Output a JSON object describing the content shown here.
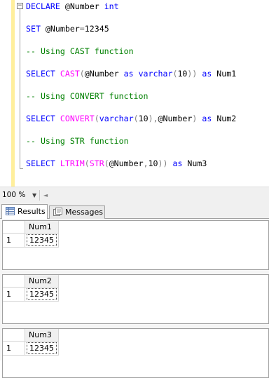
{
  "editor": {
    "collapse_glyph": "−",
    "lines": [
      {
        "segments": [
          {
            "t": "DECLARE ",
            "c": "kw"
          },
          {
            "t": "@Number ",
            "c": ""
          },
          {
            "t": "int",
            "c": "kw"
          }
        ]
      },
      {
        "segments": [
          {
            "t": "SET ",
            "c": "kw"
          },
          {
            "t": "@Number",
            "c": ""
          },
          {
            "t": "=",
            "c": "op"
          },
          {
            "t": "12345",
            "c": ""
          }
        ]
      },
      {
        "segments": [
          {
            "t": "-- Using CAST function",
            "c": "cm"
          }
        ]
      },
      {
        "segments": [
          {
            "t": "SELECT ",
            "c": "kw"
          },
          {
            "t": "CAST",
            "c": "fn"
          },
          {
            "t": "(",
            "c": "op"
          },
          {
            "t": "@Number ",
            "c": ""
          },
          {
            "t": "as ",
            "c": "kw"
          },
          {
            "t": "varchar",
            "c": "kw"
          },
          {
            "t": "(",
            "c": "op"
          },
          {
            "t": "10",
            "c": ""
          },
          {
            "t": "))",
            "c": "op"
          },
          {
            "t": " as ",
            "c": "kw"
          },
          {
            "t": "Num1",
            "c": ""
          }
        ]
      },
      {
        "segments": [
          {
            "t": "-- Using CONVERT function",
            "c": "cm"
          }
        ]
      },
      {
        "segments": [
          {
            "t": "SELECT ",
            "c": "kw"
          },
          {
            "t": "CONVERT",
            "c": "fn"
          },
          {
            "t": "(",
            "c": "op"
          },
          {
            "t": "varchar",
            "c": "kw"
          },
          {
            "t": "(",
            "c": "op"
          },
          {
            "t": "10",
            "c": ""
          },
          {
            "t": "),",
            "c": "op"
          },
          {
            "t": "@Number",
            "c": ""
          },
          {
            "t": ")",
            "c": "op"
          },
          {
            "t": " as ",
            "c": "kw"
          },
          {
            "t": "Num2",
            "c": ""
          }
        ]
      },
      {
        "segments": [
          {
            "t": "-- Using STR function",
            "c": "cm"
          }
        ]
      },
      {
        "segments": [
          {
            "t": "SELECT ",
            "c": "kw"
          },
          {
            "t": "LTRIM",
            "c": "fn"
          },
          {
            "t": "(",
            "c": "op"
          },
          {
            "t": "STR",
            "c": "fn"
          },
          {
            "t": "(",
            "c": "op"
          },
          {
            "t": "@Number",
            "c": ""
          },
          {
            "t": ",",
            "c": "op"
          },
          {
            "t": "10",
            "c": ""
          },
          {
            "t": "))",
            "c": "op"
          },
          {
            "t": " as ",
            "c": "kw"
          },
          {
            "t": "Num3",
            "c": ""
          }
        ]
      }
    ]
  },
  "colors": {
    "keyword": "#0000ff",
    "function": "#ff00ff",
    "operator": "#808080",
    "comment": "#008000",
    "change_bar": "#ffef9c"
  },
  "zoom": {
    "value": "100 %",
    "arrow_icon": "dropdown-arrow-icon",
    "scroll_icon": "scroll-left-icon"
  },
  "tabs": [
    {
      "label": "Results",
      "icon": "grid-icon",
      "active": true
    },
    {
      "label": "Messages",
      "icon": "messages-icon",
      "active": false
    }
  ],
  "results": [
    {
      "column": "Num1",
      "row_number": "1",
      "value": "12345"
    },
    {
      "column": "Num2",
      "row_number": "1",
      "value": "12345"
    },
    {
      "column": "Num3",
      "row_number": "1",
      "value": "12345"
    }
  ]
}
